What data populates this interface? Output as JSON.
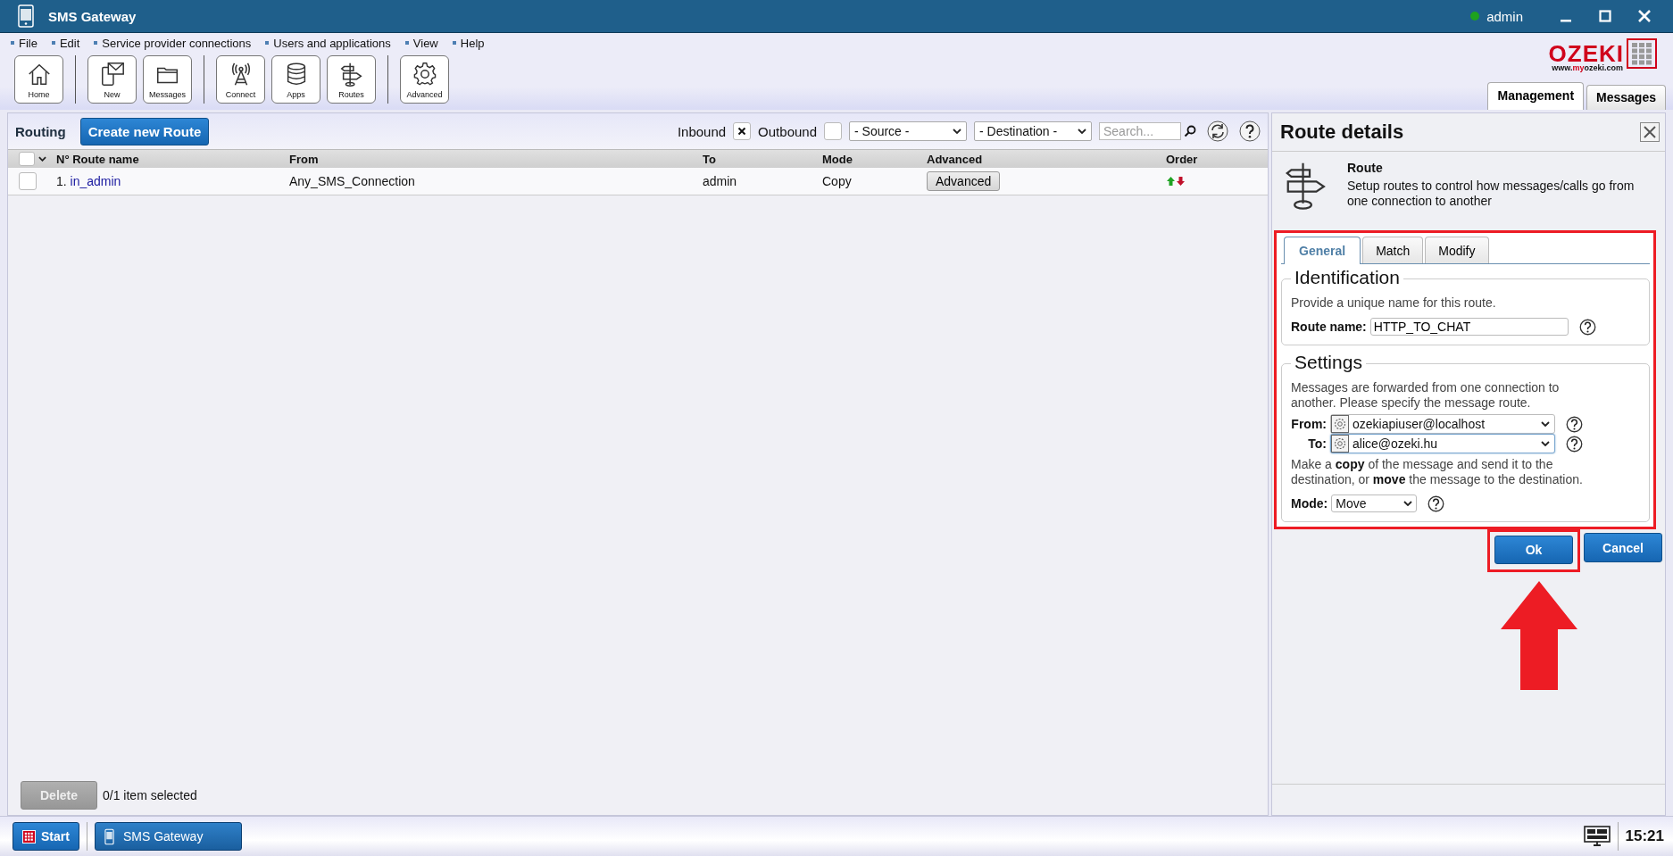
{
  "window": {
    "title": "SMS Gateway",
    "user": "admin",
    "user_online": true
  },
  "menu": [
    "File",
    "Edit",
    "Service provider connections",
    "Users and applications",
    "View",
    "Help"
  ],
  "toolbar": [
    [
      {
        "label": "Home",
        "kind": "home"
      }
    ],
    [
      {
        "label": "New",
        "kind": "new"
      },
      {
        "label": "Messages",
        "kind": "folder"
      }
    ],
    [
      {
        "label": "Connect",
        "kind": "antenna"
      },
      {
        "label": "Apps",
        "kind": "database"
      },
      {
        "label": "Routes",
        "kind": "signpost"
      }
    ],
    [
      {
        "label": "Advanced",
        "kind": "gear"
      }
    ]
  ],
  "logo": {
    "name": "OZEKI",
    "url_start": "www.",
    "url_accent": "my",
    "url_end": "ozeki.com"
  },
  "main_tabs": [
    {
      "label": "Management",
      "selected": true
    },
    {
      "label": "Messages",
      "selected": false
    }
  ],
  "routing": {
    "title": "Routing",
    "create_button": "Create new Route",
    "inbound_label": "Inbound",
    "inbound_checked": true,
    "outbound_label": "Outbound",
    "outbound_checked": false,
    "source": "- Source -",
    "destination": "- Destination -",
    "search_placeholder": "Search..."
  },
  "table": {
    "select_all_checked": false,
    "columns": [
      "N°",
      "Route name",
      "From",
      "To",
      "Mode",
      "Advanced",
      "Order"
    ],
    "rows": [
      {
        "number": "1.",
        "name": "in_admin",
        "from": "Any_SMS_Connection",
        "to": "admin",
        "mode": "Copy",
        "advanced": "Advanced",
        "selected": false
      }
    ]
  },
  "footer": {
    "delete_button": "Delete",
    "delete_disabled": true,
    "selection": "0/1 item selected"
  },
  "details": {
    "title": "Route details",
    "heading": "Route",
    "description": "Setup routes to control how messages/calls go from one connection to another",
    "tabs": [
      {
        "label": "General",
        "selected": true
      },
      {
        "label": "Match",
        "selected": false
      },
      {
        "label": "Modify",
        "selected": false
      }
    ],
    "identification": {
      "legend": "Identification",
      "hint": "Provide a unique name for this route.",
      "label": "Route name:",
      "value": "HTTP_TO_CHAT"
    },
    "settings": {
      "legend": "Settings",
      "hint": "Messages are forwarded from one connection to another. Please specify the message route.",
      "from_label": "From:",
      "from_value": "ozekiapiuser@localhost",
      "to_label": "To:",
      "to_value": "alice@ozeki.hu",
      "mode_hint": "Make a **copy** of the message and send it to the destination, or **move** the message to the destination.",
      "mode_label": "Mode:",
      "mode_value": "Move"
    },
    "ok_button": "Ok",
    "cancel_button": "Cancel"
  },
  "taskbar": {
    "start": "Start",
    "apps": [
      {
        "label": "SMS Gateway",
        "selected": true
      }
    ],
    "clock": "15:21"
  }
}
